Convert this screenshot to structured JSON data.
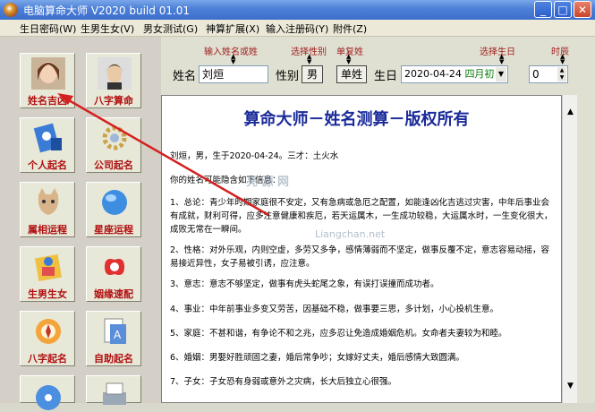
{
  "window": {
    "title": "电脑算命大师  V2020 build 01.01",
    "min": "_",
    "max": "□",
    "close": "✕"
  },
  "menu": [
    "生日密码(W)",
    "生男生女(V)",
    "男女测试(G)",
    "神算扩展(X)",
    "输入注册码(Y)",
    "附件(Z)"
  ],
  "tiles": [
    "姓名吉凶",
    "八字算命",
    "个人起名",
    "公司起名",
    "属相运程",
    "星座运程",
    "生男生女",
    "姻缘速配",
    "八字起名",
    "自助起名"
  ],
  "hints": {
    "name": "输入姓名或姓",
    "gender": "选择性别",
    "single": "单复姓",
    "birthday": "选择生日",
    "hour": "时辰"
  },
  "form": {
    "name_label": "姓名",
    "name_value": "刘烜",
    "gender_label": "性别",
    "gender_value": "男",
    "single_button": "单姓",
    "birthday_label": "生日",
    "date_value": "2020-04-24",
    "lunar_value": "四月初二",
    "hour_value": "0"
  },
  "content": {
    "title": "算命大师－姓名测算－版权所有",
    "intro": "刘烜，男，生于2020-04-24。三才：土火水",
    "lead": "你的姓名可能隐含如下信息：",
    "items": [
      "1、总论：青少年时期家庭很不安定，又有急病或急厄之配置，如能逢凶化吉逃过灾害，中年后事业会有成就，财利可得，应多注意健康和疾厄，若天运属木，一生成功较稳，大运属水时，一生变化很大，成败无常在一瞬间。",
      "2、性格：对外乐观，内则空虚，多劳又多争，感情薄弱而不坚定，做事反覆不定，意志容易动摇，容易接近异性，女子易被引诱，应注意。",
      "3、意志：意志不够坚定，做事有虎头蛇尾之象，有误打误撞而成功者。",
      "4、事业：中年前事业多变又劳苦，因基础不稳，做事要三思，多计划，小心投机生意。",
      "5、家庭：不甚和谐，有争论不和之兆，应多忍让免造成婚姻危机。女命者夫妻较为和睦。",
      "6、婚姻：男娶好胜顽固之妻，婚后常争吵；女嫁好丈夫，婚后感情大致圆满。",
      "7、子女：子女恐有身弱或意外之灾病，长大后独立心很强。"
    ]
  },
  "watermark": {
    "brand": "亮 源 网",
    "url": "Liangchan.net"
  }
}
